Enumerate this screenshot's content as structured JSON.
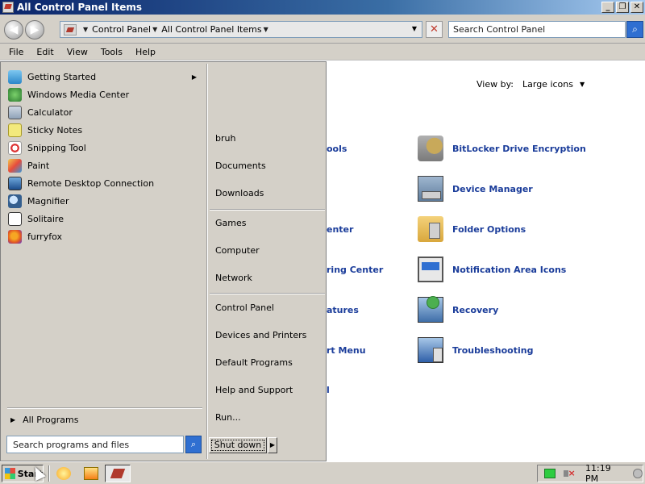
{
  "window": {
    "title": "All Control Panel Items",
    "buttons": {
      "minimize": "_",
      "maximize": "❐",
      "close": "✕"
    }
  },
  "address": {
    "breadcrumbs": [
      "Control Panel",
      "All Control Panel Items"
    ],
    "search_placeholder": "Search Control Panel"
  },
  "menu": [
    "File",
    "Edit",
    "View",
    "Tools",
    "Help"
  ],
  "content": {
    "view_by_label": "View by:",
    "view_by_value": "Large icons",
    "partial_items": [
      "ools",
      "enter",
      "ring Center",
      "atures",
      "rt Menu",
      "l"
    ],
    "items": [
      {
        "label": "BitLocker Drive Encryption",
        "icon": "bitlocker-icon"
      },
      {
        "label": "Device Manager",
        "icon": "device-manager-icon"
      },
      {
        "label": "Folder Options",
        "icon": "folder-options-icon"
      },
      {
        "label": "Notification Area Icons",
        "icon": "notification-area-icon"
      },
      {
        "label": "Recovery",
        "icon": "recovery-icon"
      },
      {
        "label": "Troubleshooting",
        "icon": "troubleshooting-icon"
      }
    ]
  },
  "start_menu": {
    "programs": [
      {
        "label": "Getting Started",
        "icon": "getting-started-icon",
        "has_submenu": true
      },
      {
        "label": "Windows Media Center",
        "icon": "media-center-icon"
      },
      {
        "label": "Calculator",
        "icon": "calculator-icon"
      },
      {
        "label": "Sticky Notes",
        "icon": "sticky-notes-icon"
      },
      {
        "label": "Snipping Tool",
        "icon": "snipping-tool-icon"
      },
      {
        "label": "Paint",
        "icon": "paint-icon"
      },
      {
        "label": "Remote Desktop Connection",
        "icon": "remote-desktop-icon"
      },
      {
        "label": "Magnifier",
        "icon": "magnifier-icon"
      },
      {
        "label": "Solitaire",
        "icon": "solitaire-icon"
      },
      {
        "label": "furryfox",
        "icon": "firefox-icon"
      }
    ],
    "all_programs": "All Programs",
    "search_placeholder": "Search programs and files",
    "right_group_1": [
      "bruh",
      "Documents",
      "Downloads"
    ],
    "right_group_2": [
      "Games",
      "Computer",
      "Network"
    ],
    "right_group_3": [
      "Control Panel",
      "Devices and Printers",
      "Default Programs",
      "Help and Support",
      "Run..."
    ],
    "shutdown": "Shut down"
  },
  "taskbar": {
    "start": "Start",
    "clock": "11:19 PM"
  }
}
